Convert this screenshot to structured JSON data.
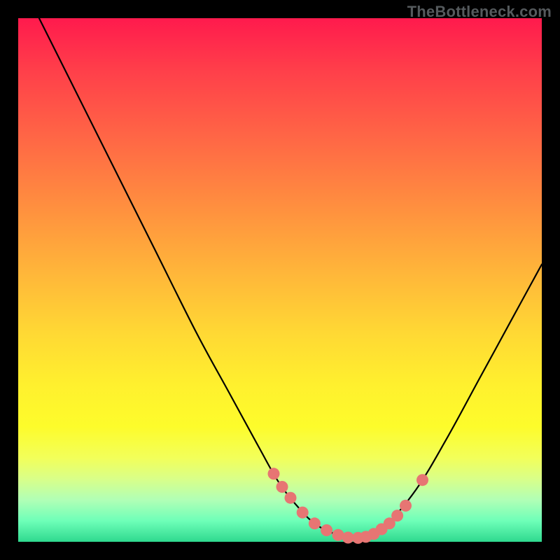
{
  "watermark": "TheBottleneck.com",
  "colors": {
    "background": "#000000",
    "curve": "#000000",
    "marker": "#e77573"
  },
  "chart_data": {
    "type": "line",
    "title": "",
    "xlabel": "",
    "ylabel": "",
    "xlim": [
      0,
      100
    ],
    "ylim": [
      0,
      100
    ],
    "grid": false,
    "series": [
      {
        "name": "curve",
        "x": [
          4,
          10,
          18,
          26,
          34,
          40,
          46,
          50,
          54,
          56,
          58,
          60,
          62,
          64,
          66,
          70,
          76,
          82,
          88,
          94,
          100
        ],
        "y": [
          100,
          88,
          72,
          56,
          40,
          29,
          18,
          11,
          6,
          4,
          2.6,
          1.7,
          1.1,
          0.7,
          0.9,
          3,
          10,
          20,
          31,
          42,
          53
        ]
      }
    ],
    "markers": {
      "name": "highlight-points",
      "x": [
        48.8,
        50.4,
        52.0,
        54.3,
        56.6,
        58.9,
        61.1,
        63.0,
        64.9,
        66.4,
        67.9,
        69.4,
        70.9,
        72.4,
        74.0,
        77.2
      ],
      "y": [
        13.0,
        10.5,
        8.4,
        5.6,
        3.5,
        2.2,
        1.3,
        0.8,
        0.75,
        0.95,
        1.5,
        2.4,
        3.5,
        5.0,
        6.9,
        11.8
      ]
    }
  }
}
